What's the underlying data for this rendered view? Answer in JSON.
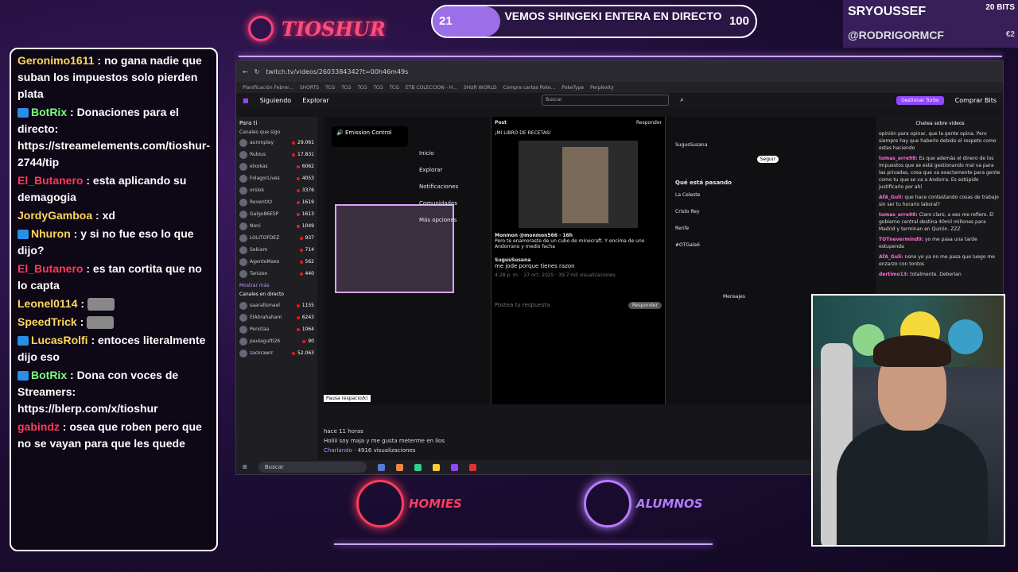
{
  "overlay": {
    "brand": "TIOSHUR",
    "goal": {
      "left": "21",
      "title": "VEMOS SHINGEKI ENTERA EN DIRECTO",
      "right": "100",
      "progress": 0.21
    },
    "recent_sub": "SRYOUSSEF",
    "recent_follow": "@RODRIGORMCF",
    "bits": "20 BITS",
    "bits2": "€2",
    "logo_homies": "HOMIES",
    "logo_alumnos": "ALUMNOS"
  },
  "chat": [
    {
      "user": "Geronimo1611",
      "cls": "",
      "badge": false,
      "text": ": no gana nadie que suban los impuestos solo pierden plata"
    },
    {
      "user": "BotRix",
      "cls": "green",
      "badge": true,
      "text": ": Donaciones para el directo: https://streamelements.com/tioshur-2744/tip"
    },
    {
      "user": "El_Butanero",
      "cls": "red",
      "badge": false,
      "text": ": esta aplicando su demagogia"
    },
    {
      "user": "JordyGamboa",
      "cls": "",
      "badge": false,
      "text": ": xd"
    },
    {
      "user": "Nhuron",
      "cls": "",
      "badge": true,
      "text": ": y si no fue eso lo que dijo?"
    },
    {
      "user": "El_Butanero",
      "cls": "red",
      "badge": false,
      "text": ": es tan cortita que no lo capta"
    },
    {
      "user": "Leonel0114",
      "cls": "",
      "badge": false,
      "text": ":",
      "emote": true
    },
    {
      "user": "SpeedTrick",
      "cls": "",
      "badge": false,
      "text": ":",
      "emote": true
    },
    {
      "user": "LucasRolfi",
      "cls": "",
      "badge": true,
      "text": ": entoces literalmente dijo eso"
    },
    {
      "user": "BotRix",
      "cls": "green",
      "badge": true,
      "text": ": Dona con voces de Streamers: https://blerp.com/x/tioshur"
    },
    {
      "user": "gabindz",
      "cls": "red",
      "badge": false,
      "text": ": osea que roben pero que no se vayan para que les quede"
    }
  ],
  "screen": {
    "url": "twitch.tv/videos/2603384342?t=00h46m49s",
    "bookmarks": [
      "Planificación Febrer...",
      "SHORTS",
      "TCG",
      "TCG",
      "TCG",
      "TCG",
      "TCG",
      "ETB COLECCION - H...",
      "SHUR WORLD",
      "Compra cartas Poke...",
      "PokeType",
      "Perplexity"
    ],
    "nav": {
      "following": "Siguiendo",
      "browse": "Explorar",
      "search": "Buscar",
      "turbo": "Gestionar Turbo",
      "bits": "Comprar Bits"
    },
    "rail_title": "Para ti",
    "rail_sub": "Canales que sigo",
    "more": "Mostrar más",
    "live": "Canales en directo",
    "rail": [
      {
        "n": "auronplay",
        "c": "29.061"
      },
      {
        "n": "Rubius",
        "c": "17.831"
      },
      {
        "n": "elxokas",
        "c": "6062"
      },
      {
        "n": "FolagorLives",
        "c": "4053"
      },
      {
        "n": "orslok",
        "c": "3376"
      },
      {
        "n": "ReventXz",
        "c": "1619"
      },
      {
        "n": "Galgo86ESP",
        "c": "1613"
      },
      {
        "n": "Noni",
        "c": "1049"
      },
      {
        "n": "LOLITOFDEZ",
        "c": "937"
      },
      {
        "n": "Sekiam",
        "c": "714"
      },
      {
        "n": "AgenteMaxo",
        "c": "562"
      },
      {
        "n": "Tanizen",
        "c": "440"
      },
      {
        "n": "saarallsmael",
        "c": "1155"
      },
      {
        "n": "ElAbrahaham",
        "c": "6243"
      },
      {
        "n": "Perxitaa",
        "c": "1064"
      },
      {
        "n": "paulagutti26",
        "c": "90"
      },
      {
        "n": "zackrawrr",
        "c": "52.063"
      }
    ],
    "emission": "Emission Control",
    "xnav": [
      "Inicio",
      "Explorar",
      "Notificaciones",
      "Comunidades",
      "Más opciones"
    ],
    "xpost": {
      "header": "Post",
      "reply_btn": "Responder",
      "caption": "¡MI LIBRO DE RECETAS!",
      "tweet1": "Monmon @monmon566 · 16h",
      "tweet1_text": "Pero te enamoraste de un cubo de minecraft. Y encima de uno Andorrano y medio facha",
      "tweet2": "SugusSusana",
      "tweet2_text": "me jode porque tienes razon",
      "meta": "4:28 p. m. · 27 oct. 2025 · 39,7 mil visualizaciones",
      "reply_ph": "Postea tu respuesta",
      "reply": "Responder"
    },
    "xright": {
      "trends": "Qué está pasando",
      "t1": "La Celeste",
      "t2": "Cristo Rey",
      "t3": "Renfe",
      "t4": "#OTGala6",
      "follow": "Seguir",
      "name": "SugusSusana",
      "messages": "Mensajes"
    },
    "pausa": "Pausa (espacio/k)",
    "under": {
      "time": "hace 11 horas",
      "title": "Holiii soy maja y me gusta meterme en líos",
      "cat": "Charlando",
      "views": "· 4916 visualizaciones"
    },
    "rchat_title": "Chatea sobre videos",
    "rchat": [
      {
        "u": "",
        "t": "opinión para opinar, que la gente opina. Pero siempre hay que haberlo debido el respeto como estas haciendo"
      },
      {
        "u": "tomas_erre98:",
        "t": "Es que además el dinero de los impuestos que se está gestionando mal va para las privadas, cosa que va exactamente para gente como tu que se va a Andorra. Es estúpido justificarlo por ahí"
      },
      {
        "u": "AfA_Guli:",
        "t": "que hace contestando cosas de trabajo sin ser tu horario laboral?"
      },
      {
        "u": "tomas_erre98:",
        "t": "Claro claro, a eso me refiero. El gobierno central destina 40mil millones para Madrid y terminan en Quirón. ZZZ"
      },
      {
        "u": "TOTnevermind0:",
        "t": "yo me pasa una tarde estupenda"
      },
      {
        "u": "AfA_Guli:",
        "t": "nono yo ya no me pasa que luego me enzarzo con tontos"
      },
      {
        "u": "dertimo13:",
        "t": "totalmente. Deberían"
      }
    ],
    "taskbar_search": "Buscar"
  },
  "colors": {
    "accent": "#9c6ee8",
    "twitch": "#9147ff",
    "brand": "#ff4d7d",
    "homies": "#ff3b5c",
    "alumnos": "#b57bff"
  }
}
